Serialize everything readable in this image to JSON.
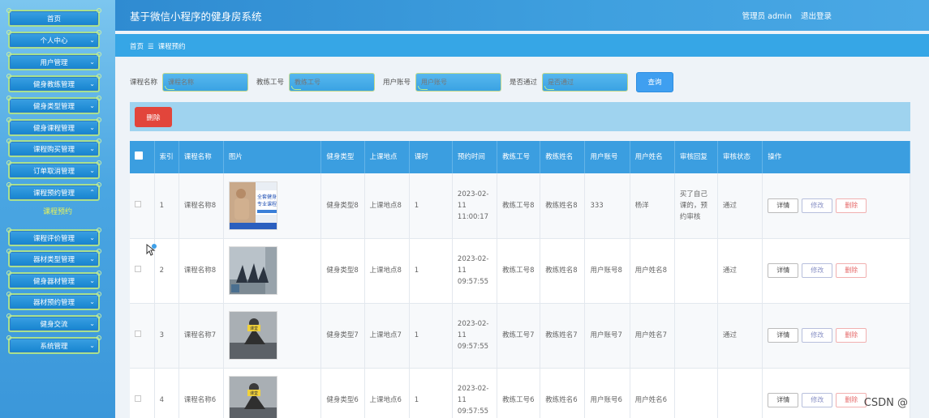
{
  "sidebar": {
    "items": [
      {
        "label": "首页"
      },
      {
        "label": "个人中心"
      },
      {
        "label": "用户管理"
      },
      {
        "label": "健身教练管理"
      },
      {
        "label": "健身类型管理"
      },
      {
        "label": "健身课程管理"
      },
      {
        "label": "课程购买管理"
      },
      {
        "label": "订单取消管理"
      },
      {
        "label": "课程预约管理"
      },
      {
        "label": "课程评价管理"
      },
      {
        "label": "器材类型管理"
      },
      {
        "label": "健身器材管理"
      },
      {
        "label": "器材预约管理"
      },
      {
        "label": "健身交流"
      },
      {
        "label": "系统管理"
      }
    ],
    "active_sub": "课程预约"
  },
  "header": {
    "title": "基于微信小程序的健身房系统",
    "user": "管理员 admin",
    "logout": "退出登录"
  },
  "breadcrumb": {
    "home": "首页",
    "sep": "☰",
    "current": "课程预约"
  },
  "search": {
    "course_name_label": "课程名称",
    "course_name_placeholder": "课程名称",
    "coach_no_label": "教练工号",
    "coach_no_placeholder": "教练工号",
    "user_acct_label": "用户账号",
    "user_acct_placeholder": "用户账号",
    "approved_label": "是否通过",
    "approved_placeholder": "是否通过",
    "query_label": "查询"
  },
  "toolbar": {
    "delete_label": "删除"
  },
  "table": {
    "headers": [
      "索引",
      "课程名称",
      "图片",
      "健身类型",
      "上课地点",
      "课时",
      "预约时间",
      "教练工号",
      "教练姓名",
      "用户账号",
      "用户姓名",
      "审核回复",
      "审核状态",
      "操作"
    ],
    "rows": [
      {
        "idx": "1",
        "course": "课程名称8",
        "type": "健身类型8",
        "place": "上课地点8",
        "hours": "1",
        "time": "2023-02-11 11:00:17",
        "coach_no": "教练工号8",
        "coach_name": "教练姓名8",
        "user_acct": "333",
        "user_name": "杨洋",
        "reply": "买了自己课的，预约审核",
        "status": "通过",
        "img_text": "全套健身 专业课程"
      },
      {
        "idx": "2",
        "course": "课程名称8",
        "type": "健身类型8",
        "place": "上课地点8",
        "hours": "1",
        "time": "2023-02-11 09:57:55",
        "coach_no": "教练工号8",
        "coach_name": "教练姓名8",
        "user_acct": "用户账号8",
        "user_name": "用户姓名8",
        "reply": "",
        "status": "通过",
        "img_text": ""
      },
      {
        "idx": "3",
        "course": "课程名称7",
        "type": "健身类型7",
        "place": "上课地点7",
        "hours": "1",
        "time": "2023-02-11 09:57:55",
        "coach_no": "教练工号7",
        "coach_name": "教练姓名7",
        "user_acct": "用户账号7",
        "user_name": "用户姓名7",
        "reply": "",
        "status": "通过",
        "img_text": "课堂"
      },
      {
        "idx": "4",
        "course": "课程名称6",
        "type": "健身类型6",
        "place": "上课地点6",
        "hours": "1",
        "time": "2023-02-11 09:57:55",
        "coach_no": "教练工号6",
        "coach_name": "教练姓名6",
        "user_acct": "用户账号6",
        "user_name": "用户姓名6",
        "reply": "",
        "status": "",
        "img_text": "课堂"
      }
    ],
    "ops": {
      "detail": "详情",
      "edit": "修改",
      "remove": "删除"
    }
  },
  "watermark": "CSDN @"
}
